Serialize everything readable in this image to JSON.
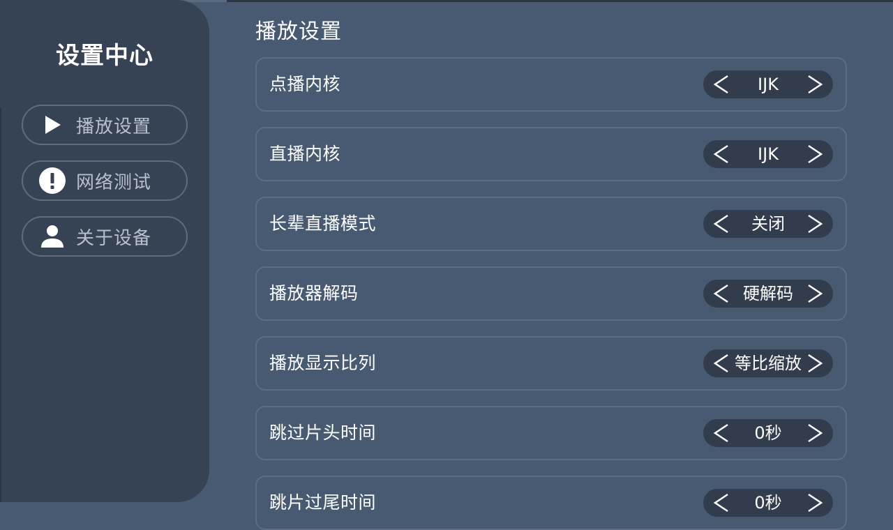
{
  "sidebar": {
    "title": "设置中心",
    "items": [
      {
        "label": "播放设置",
        "icon": "play-icon"
      },
      {
        "label": "网络测试",
        "icon": "alert-circle-icon"
      },
      {
        "label": "关于设备",
        "icon": "person-icon"
      }
    ]
  },
  "main": {
    "title": "播放设置",
    "settings": [
      {
        "label": "点播内核",
        "value": "IJK"
      },
      {
        "label": "直播内核",
        "value": "IJK"
      },
      {
        "label": "长辈直播模式",
        "value": "关闭"
      },
      {
        "label": "播放器解码",
        "value": "硬解码"
      },
      {
        "label": "播放显示比列",
        "value": "等比缩放"
      },
      {
        "label": "跳过片头时间",
        "value": "0秒"
      },
      {
        "label": "跳片过尾时间",
        "value": "0秒"
      }
    ]
  },
  "colors": {
    "background": "#475a72",
    "sidebar": "#364354",
    "selector": "#313d4d",
    "row_border": "#5b6c83",
    "nav_label": "#b7c0cc"
  }
}
